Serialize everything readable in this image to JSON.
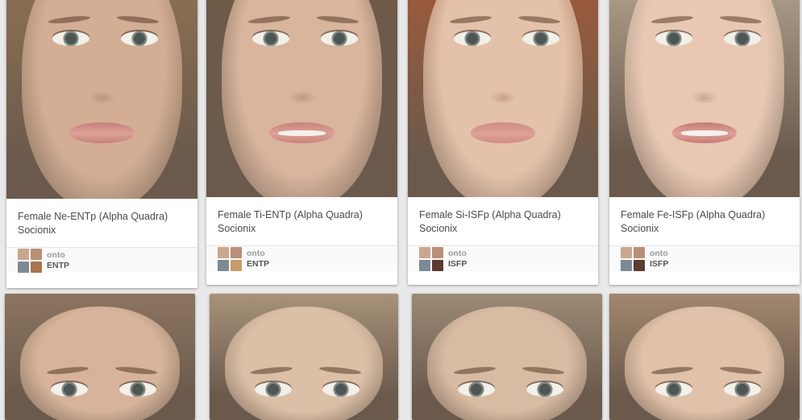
{
  "pins": [
    {
      "id": "p1",
      "caption_line1": "Female Ne-ENTp (Alpha Quadra)",
      "caption_line2": "Socionix",
      "user": "onto",
      "board": "ENTP",
      "colors": {
        "hair": "#8a6e52",
        "skin": "#d3ae95",
        "mouth": "#c4807a"
      },
      "mouth_open": false
    },
    {
      "id": "p2",
      "caption_line1": "Female Ti-ENTp (Alpha Quadra)",
      "caption_line2": "Socionix",
      "user": "onto",
      "board": "ENTP",
      "colors": {
        "hair": "#6f5a48",
        "skin": "#d9b59e",
        "mouth": "#c98479"
      },
      "mouth_open": true
    },
    {
      "id": "p3",
      "caption_line1": "Female Si-ISFp (Alpha Quadra)",
      "caption_line2": "Socionix",
      "user": "onto",
      "board": "ISFP",
      "colors": {
        "hair": "#9a5a3c",
        "skin": "#e4c2aa",
        "mouth": "#cf8d84"
      },
      "mouth_open": false
    },
    {
      "id": "p4",
      "caption_line1": "Female Fe-ISFp (Alpha Quadra)",
      "caption_line2": "Socionix",
      "user": "onto",
      "board": "ISFP",
      "colors": {
        "hair": "#a89a86",
        "skin": "#e8c8b3",
        "mouth": "#c87a78"
      },
      "mouth_open": true
    },
    {
      "id": "p5",
      "colors": {
        "hair": "#8c7560",
        "skin": "#d6b39a"
      }
    },
    {
      "id": "p6",
      "colors": {
        "hair": "#a8927a",
        "skin": "#dcbfa7"
      }
    },
    {
      "id": "p7",
      "colors": {
        "hair": "#9d8a76",
        "skin": "#d8bba3"
      }
    },
    {
      "id": "p8",
      "colors": {
        "hair": "#a2876e",
        "skin": "#e0c1a9"
      }
    }
  ]
}
